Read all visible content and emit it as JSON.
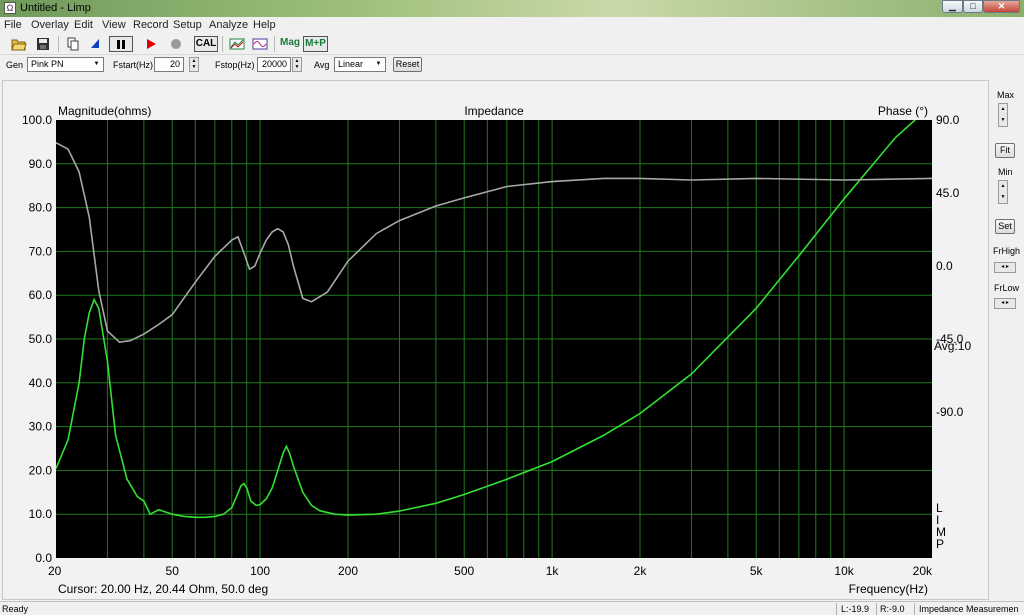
{
  "window": {
    "title": "Untitled - Limp",
    "icon": "app-icon",
    "buttons": [
      "minimize-icon",
      "maximize-icon",
      "close-icon"
    ]
  },
  "menu": [
    "File",
    "Overlay",
    "Edit",
    "View",
    "Record",
    "Setup",
    "Analyze",
    "Help"
  ],
  "toolbar": {
    "icons": [
      "open-folder-icon",
      "save-icon",
      "copy-icon",
      "marker-icon",
      "pause-icon",
      "record-icon",
      "stop-icon",
      "cal-icon",
      "overlay-icon",
      "waveform-icon"
    ],
    "cal_label": "CAL",
    "mag_label": "Mag",
    "mp_label": "M+P",
    "record_color": "#e00000",
    "stop_color": "#9a9a9a"
  },
  "controls": {
    "gen_label": "Gen",
    "gen_value": "Pink PN",
    "fstart_label": "Fstart(Hz)",
    "fstart_value": "20",
    "fstop_label": "Fstop(Hz)",
    "fstop_value": "20000",
    "avg_label": "Avg",
    "avg_value": "Linear",
    "reset_label": "Reset"
  },
  "side": {
    "max_label": "Max",
    "fit_label": "Fit",
    "min_label": "Min",
    "set_label": "Set",
    "frhigh_label": "FrHigh",
    "frlow_label": "FrLow"
  },
  "plot": {
    "avg_text": "Avg:10",
    "watermark": [
      "L",
      "I",
      "M",
      "P"
    ],
    "cursor_text": "Cursor: 20.00 Hz, 20.44 Ohm, 50.0 deg"
  },
  "chart_data": {
    "type": "line",
    "title": "Impedance",
    "ylabel_left": "Magnitude(ohms)",
    "ylabel_right": "Phase (°)",
    "xlabel": "Frequency(Hz)",
    "x_scale": "log",
    "xlim": [
      20,
      20000
    ],
    "ylim_left": [
      0,
      100
    ],
    "ylim_right": [
      -180,
      90
    ],
    "grid": true,
    "background": "#000000",
    "grid_color": "#1f7a1f",
    "x_ticks": [
      20,
      50,
      100,
      200,
      500,
      1000,
      2000,
      5000,
      10000,
      20000
    ],
    "x_tick_labels": [
      "20",
      "50",
      "100",
      "200",
      "500",
      "1k",
      "2k",
      "5k",
      "10k",
      "20k"
    ],
    "y_ticks_left": [
      0,
      10,
      20,
      30,
      40,
      50,
      60,
      70,
      80,
      90,
      100
    ],
    "y_tick_labels_left": [
      "0.0",
      "10.0",
      "20.0",
      "30.0",
      "40.0",
      "50.0",
      "60.0",
      "70.0",
      "80.0",
      "90.0",
      "100.0"
    ],
    "y_ticks_right": [
      90,
      45,
      0,
      -45,
      -90
    ],
    "y_tick_labels_right": [
      "90.0",
      "45.0",
      "0.0",
      "-45.0",
      "-90.0"
    ],
    "series": [
      {
        "name": "Magnitude",
        "color": "#33e033",
        "axis": "left",
        "x": [
          20,
          22,
          24,
          25,
          26,
          27,
          28,
          30,
          32,
          35,
          38,
          40,
          42,
          45,
          50,
          55,
          60,
          65,
          70,
          75,
          80,
          83,
          86,
          88,
          90,
          93,
          97,
          100,
          105,
          110,
          115,
          120,
          123,
          126,
          130,
          140,
          150,
          160,
          180,
          200,
          250,
          300,
          400,
          500,
          700,
          1000,
          1500,
          2000,
          3000,
          5000,
          7000,
          10000,
          15000,
          17500
        ],
        "y": [
          20.4,
          27,
          40,
          50,
          56,
          59,
          57,
          45,
          28,
          18,
          14,
          13,
          10,
          11,
          10,
          9.5,
          9.3,
          9.3,
          9.5,
          10,
          11.5,
          14,
          16.5,
          17,
          16,
          13,
          12,
          12.2,
          13.5,
          16,
          20,
          24,
          25.5,
          24,
          21,
          15,
          12,
          10.8,
          10,
          9.8,
          10,
          10.7,
          12.5,
          14.5,
          18,
          22,
          28,
          33,
          42,
          57,
          69,
          82,
          96,
          100
        ]
      },
      {
        "name": "Phase",
        "color": "#a8a8a8",
        "axis": "right",
        "x": [
          20,
          22,
          24,
          26,
          28,
          30,
          33,
          36,
          40,
          45,
          50,
          60,
          70,
          80,
          84,
          88,
          92,
          96,
          100,
          105,
          110,
          115,
          120,
          125,
          130,
          140,
          150,
          170,
          200,
          250,
          300,
          400,
          500,
          700,
          1000,
          1500,
          2000,
          3000,
          5000,
          10000,
          20000
        ],
        "y": [
          76,
          72,
          58,
          30,
          -15,
          -40,
          -47,
          -46,
          -42,
          -36,
          -30,
          -10,
          6,
          16,
          18,
          8,
          -2,
          0,
          8,
          16,
          21,
          23,
          21,
          13,
          0,
          -20,
          -22,
          -16,
          3,
          20,
          28,
          37,
          42,
          49,
          52,
          54,
          54,
          53,
          54,
          53,
          54
        ]
      }
    ]
  },
  "status": {
    "ready": "Ready",
    "l_value": "L:-19.9",
    "r_value": "R:-9.0",
    "mode": "Impedance Measuremen"
  }
}
